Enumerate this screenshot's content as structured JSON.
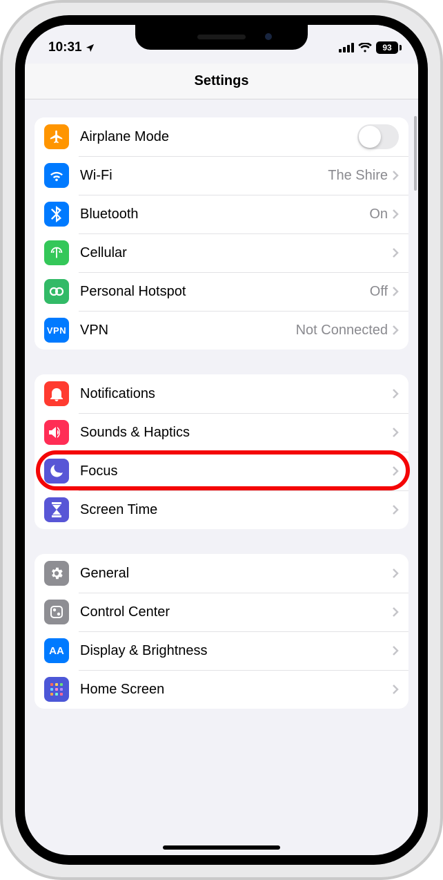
{
  "status": {
    "time": "10:31",
    "battery": "93"
  },
  "nav": {
    "title": "Settings"
  },
  "group1": {
    "airplane": {
      "label": "Airplane Mode"
    },
    "wifi": {
      "label": "Wi-Fi",
      "value": "The Shire"
    },
    "bluetooth": {
      "label": "Bluetooth",
      "value": "On"
    },
    "cellular": {
      "label": "Cellular"
    },
    "hotspot": {
      "label": "Personal Hotspot",
      "value": "Off"
    },
    "vpn": {
      "label": "VPN",
      "value": "Not Connected"
    }
  },
  "group2": {
    "notifications": {
      "label": "Notifications"
    },
    "sounds": {
      "label": "Sounds & Haptics"
    },
    "focus": {
      "label": "Focus"
    },
    "screentime": {
      "label": "Screen Time"
    }
  },
  "group3": {
    "general": {
      "label": "General"
    },
    "control": {
      "label": "Control Center"
    },
    "display": {
      "label": "Display & Brightness"
    },
    "home": {
      "label": "Home Screen"
    }
  }
}
